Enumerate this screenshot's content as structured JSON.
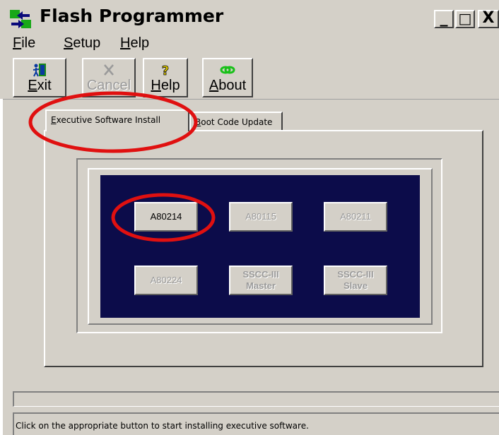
{
  "window": {
    "title": "Flash Programmer",
    "controls": {
      "minimize": "_",
      "maximize": "□",
      "close": "X"
    }
  },
  "menu": [
    {
      "accel": "F",
      "rest": "ile"
    },
    {
      "accel": "S",
      "rest": "etup"
    },
    {
      "accel": "H",
      "rest": "elp"
    }
  ],
  "toolbar": {
    "exit": {
      "accel": "E",
      "rest": "xit",
      "icon": "exit-door-icon"
    },
    "cancel": {
      "label": "Cancel",
      "icon": "cancel-x-icon",
      "disabled": true
    },
    "help": {
      "accel": "H",
      "rest": "elp",
      "icon": "help-question-icon"
    },
    "about": {
      "accel": "A",
      "rest": "bout",
      "icon": "about-link-icon"
    }
  },
  "tabs": [
    {
      "accel": "E",
      "rest": "xecutive Software Install",
      "active": true
    },
    {
      "accel": "B",
      "rest": "oot Code Update",
      "active": false
    }
  ],
  "buttons": {
    "a80214": "A80214",
    "a80115": "A80115",
    "a80211": "A80211",
    "a80224": "A80224",
    "sscc_master_line1": "SSCC-III",
    "sscc_master_line2": "Master",
    "sscc_slave_line1": "SSCC-III",
    "sscc_slave_line2": "Slave"
  },
  "status": {
    "message": "Click on the appropriate button to start installing executive software."
  },
  "colors": {
    "window_bg": "#d4d0c8",
    "panel_bg": "#0c0c4a",
    "annotation": "#e01010"
  }
}
